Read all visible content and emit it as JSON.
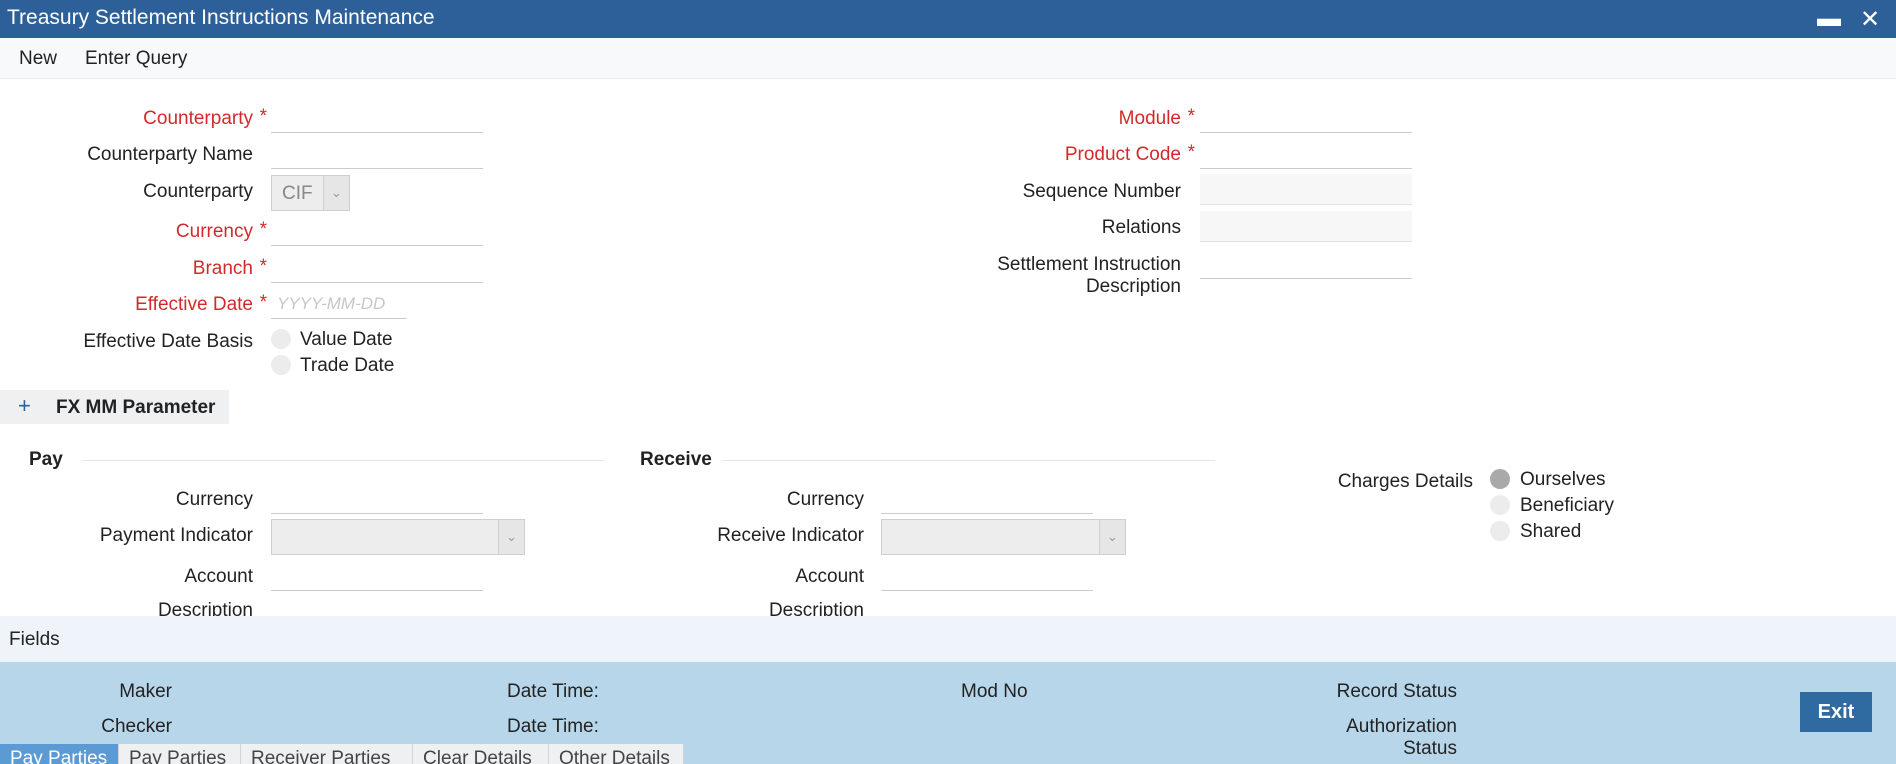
{
  "window": {
    "title": "Treasury Settlement Instructions Maintenance",
    "minimize_icon": "minimize-icon",
    "close_icon": "close-icon"
  },
  "menu": {
    "new": "New",
    "enter_query": "Enter Query"
  },
  "header_left": {
    "counterparty": "Counterparty",
    "counterparty_name": "Counterparty Name",
    "counterparty_type": "Counterparty",
    "counterparty_type_value": "CIF",
    "currency": "Currency",
    "branch": "Branch",
    "effective_date": "Effective Date",
    "effective_date_placeholder": "YYYY-MM-DD",
    "effective_date_basis": "Effective Date Basis",
    "basis_options": [
      "Value Date",
      "Trade Date"
    ],
    "required_mark": "*"
  },
  "header_right": {
    "module": "Module",
    "product_code": "Product Code",
    "sequence_number": "Sequence Number",
    "relations": "Relations",
    "settlement_desc_line1": "Settlement Instruction",
    "settlement_desc_line2": "Description"
  },
  "section": {
    "title": "FX MM Parameter",
    "toggle_icon": "plus-icon"
  },
  "pay": {
    "title": "Pay",
    "currency": "Currency",
    "indicator": "Payment Indicator",
    "account": "Account",
    "description": "Description"
  },
  "receive": {
    "title": "Receive",
    "currency": "Currency",
    "indicator": "Receive Indicator",
    "account": "Account",
    "description": "Description"
  },
  "charges": {
    "label": "Charges Details",
    "options": [
      "Ourselves",
      "Beneficiary",
      "Shared"
    ],
    "selected": "Ourselves"
  },
  "fields_bar": {
    "label": "Fields"
  },
  "audit": {
    "maker": "Maker",
    "checker": "Checker",
    "date_time_1": "Date Time:",
    "date_time_2": "Date Time:",
    "mod_no": "Mod No",
    "record_status": "Record Status",
    "auth_status_line1": "Authorization",
    "auth_status_line2": "Status",
    "exit": "Exit"
  },
  "tabs": [
    "Pay Parties",
    "Pay Parties",
    "Receiver Parties",
    "Clear Details",
    "Other Details"
  ],
  "colors": {
    "title_bar": "#2d6099",
    "required": "#d22a2a",
    "audit_bg": "#b8d6ea",
    "exit_button": "#2f6aa0",
    "active_tab": "#5b9ad3"
  }
}
